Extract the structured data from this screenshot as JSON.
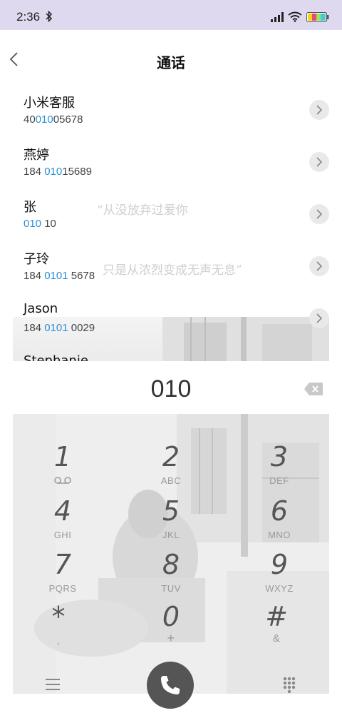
{
  "status_bar": {
    "time": "2:36"
  },
  "header": {
    "title": "通话"
  },
  "contacts": [
    {
      "name": "小米客服",
      "number_pre": "40",
      "number_match": "010",
      "number_post": "05678"
    },
    {
      "name": "燕婷",
      "number_pre": "184 ",
      "number_match": "010",
      "number_post": "15689"
    },
    {
      "name": "张",
      "number_pre": "",
      "number_match": "010",
      "number_post": " 10"
    },
    {
      "name": "子玲",
      "number_pre": "184 ",
      "number_match": "0101",
      "number_post": " 5678"
    },
    {
      "name": "Jason",
      "number_pre": "184 ",
      "number_match": "0101",
      "number_post": " 0029"
    },
    {
      "name": "Stephanie",
      "number_pre": "",
      "number_match": "",
      "number_post": ""
    }
  ],
  "watermark": {
    "line1": "“从没放弃过爱你",
    "line2": "只是从浓烈变成无声无息”"
  },
  "dialer": {
    "digits": "010",
    "keys": [
      {
        "digit": "1",
        "letters": ""
      },
      {
        "digit": "2",
        "letters": "ABC"
      },
      {
        "digit": "3",
        "letters": "DEF"
      },
      {
        "digit": "4",
        "letters": "GHI"
      },
      {
        "digit": "5",
        "letters": "JKL"
      },
      {
        "digit": "6",
        "letters": "MNO"
      },
      {
        "digit": "7",
        "letters": "PQRS"
      },
      {
        "digit": "8",
        "letters": "TUV"
      },
      {
        "digit": "9",
        "letters": "WXYZ"
      },
      {
        "digit": "*",
        "letters": ","
      },
      {
        "digit": "0",
        "letters": "+"
      },
      {
        "digit": "#",
        "letters": "&"
      }
    ]
  },
  "icons": {
    "back": "chevron-left-icon",
    "detail": "chevron-right-icon",
    "backspace": "backspace-icon",
    "voicemail": "voicemail-icon",
    "menu": "menu-icon",
    "call": "phone-icon",
    "dialpad": "dialpad-icon"
  },
  "colors": {
    "status_bar": "#ded9ee",
    "match_highlight": "#2a8fd6",
    "call_button": "#555555"
  }
}
